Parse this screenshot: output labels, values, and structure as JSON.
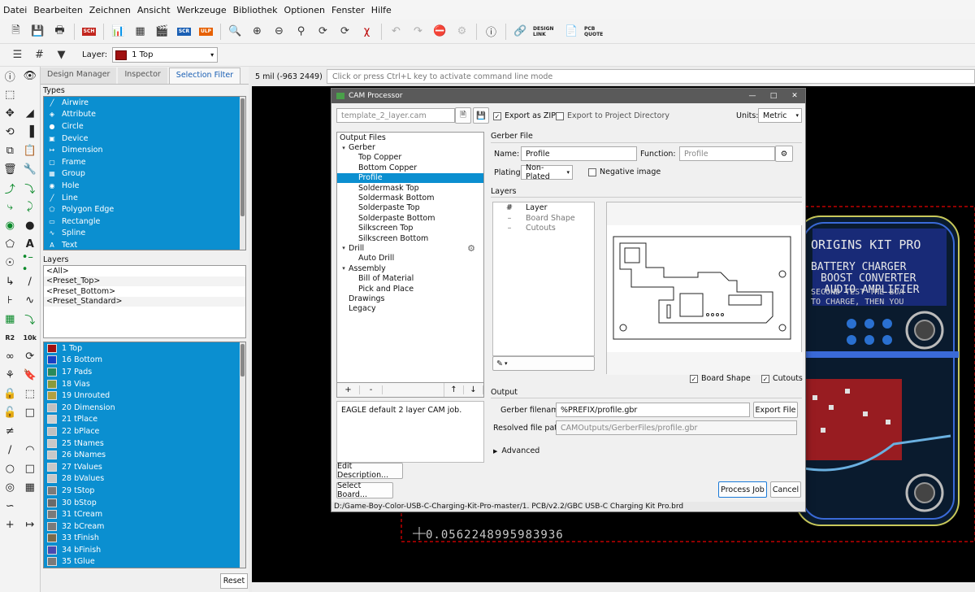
{
  "menubar": [
    "Datei",
    "Bearbeiten",
    "Zeichnen",
    "Ansicht",
    "Werkzeuge",
    "Bibliothek",
    "Optionen",
    "Fenster",
    "Hilfe"
  ],
  "toolbar": {
    "sch_label": "SCH",
    "scr_label": "SCR",
    "ulp_label": "ULP",
    "design_link": "DESIGN LINK",
    "pcb_quote": "PCB QUOTE",
    "layer_label": "Layer:",
    "layer_value": "1 Top",
    "layer_color": "#a01010"
  },
  "panel": {
    "tabs": [
      "Design Manager",
      "Inspector",
      "Selection Filter"
    ],
    "active_tab": "Selection Filter",
    "types_title": "Types",
    "types": [
      "Airwire",
      "Attribute",
      "Circle",
      "Device",
      "Dimension",
      "Frame",
      "Group",
      "Hole",
      "Line",
      "Polygon Edge",
      "Rectangle",
      "Spline",
      "Text"
    ],
    "layers_title": "Layers",
    "presets": [
      "<All>",
      "<Preset_Top>",
      "<Preset_Bottom>",
      "<Preset_Standard>"
    ],
    "layers": [
      {
        "name": "1 Top",
        "color": "#a01010"
      },
      {
        "name": "16 Bottom",
        "color": "#1a3fc4"
      },
      {
        "name": "17 Pads",
        "color": "#2a8a5a"
      },
      {
        "name": "18 Vias",
        "color": "#8a9a3a"
      },
      {
        "name": "19 Unrouted",
        "color": "#b0a040"
      },
      {
        "name": "20 Dimension",
        "color": "#c0c0c0"
      },
      {
        "name": "21 tPlace",
        "color": "#d0d0d0"
      },
      {
        "name": "22 bPlace",
        "color": "#c0c0c0"
      },
      {
        "name": "25 tNames",
        "color": "#c8c8c8"
      },
      {
        "name": "26 bNames",
        "color": "#c8c8c8"
      },
      {
        "name": "27 tValues",
        "color": "#c8c8c8"
      },
      {
        "name": "28 bValues",
        "color": "#c8c8c8"
      },
      {
        "name": "29 tStop",
        "color": "#7a7a7a"
      },
      {
        "name": "30 bStop",
        "color": "#6a6a6a"
      },
      {
        "name": "31 tCream",
        "color": "#7a7a7a"
      },
      {
        "name": "32 bCream",
        "color": "#7a7a7a"
      },
      {
        "name": "33 tFinish",
        "color": "#7a6a4a"
      },
      {
        "name": "34 bFinish",
        "color": "#4a4ab0"
      },
      {
        "name": "35 tGlue",
        "color": "#7a7a7a"
      }
    ],
    "reset_label": "Reset"
  },
  "command": {
    "coord": "5 mil (-963 2449)",
    "placeholder": "Click or press Ctrl+L key to activate command line mode"
  },
  "canvas": {
    "silk_lines": [
      "ORIGINS KIT PRO",
      "BATTERY CHARGER",
      "BOOST CONVERTER",
      "AUDIO AMPLIFIER",
      "SECOND TEST THE BOA",
      "TO CHARGE, THEN YOU"
    ],
    "measure_value": "0.0562248995983936"
  },
  "cam": {
    "title": "CAM Processor",
    "job_file": "template_2_layer.cam",
    "export_zip": "Export as ZIP",
    "export_zip_checked": true,
    "export_project": "Export to Project Directory",
    "export_project_checked": false,
    "units_label": "Units:",
    "units_value": "Metric",
    "output_files_title": "Output Files",
    "tree": [
      {
        "label": "Gerber",
        "level": 0,
        "expand": true
      },
      {
        "label": "Top Copper",
        "level": 1
      },
      {
        "label": "Bottom Copper",
        "level": 1
      },
      {
        "label": "Profile",
        "level": 1,
        "selected": true
      },
      {
        "label": "Soldermask Top",
        "level": 1
      },
      {
        "label": "Soldermask Bottom",
        "level": 1
      },
      {
        "label": "Solderpaste Top",
        "level": 1
      },
      {
        "label": "Solderpaste Bottom",
        "level": 1
      },
      {
        "label": "Silkscreen Top",
        "level": 1
      },
      {
        "label": "Silkscreen Bottom",
        "level": 1
      },
      {
        "label": "Drill",
        "level": 0,
        "expand": true,
        "gear": true
      },
      {
        "label": "Auto Drill",
        "level": 1
      },
      {
        "label": "Assembly",
        "level": 0,
        "expand": true
      },
      {
        "label": "Bill of Material",
        "level": 1
      },
      {
        "label": "Pick and Place",
        "level": 1
      },
      {
        "label": "Drawings",
        "level": 0
      },
      {
        "label": "Legacy",
        "level": 0
      }
    ],
    "tree_buttons": [
      "+",
      "-",
      "↑",
      "↓"
    ],
    "description": "EAGLE default 2 layer CAM job.",
    "edit_description": "Edit Description...",
    "select_board": "Select Board...",
    "gerber_file_title": "Gerber File",
    "name_label": "Name:",
    "name_value": "Profile",
    "function_label": "Function:",
    "function_value": "Profile",
    "plating_label": "Plating:",
    "plating_value": "Non-Plated",
    "negative_image": "Negative image",
    "layers_title": "Layers",
    "layer_col_hash": "#",
    "layer_col_name": "Layer",
    "layer_rows": [
      {
        "mark": "–",
        "name": "Board Shape"
      },
      {
        "mark": "–",
        "name": "Cutouts"
      }
    ],
    "board_shape_chk": "Board Shape",
    "cutouts_chk": "Cutouts",
    "output_title": "Output",
    "gerber_filename_label": "Gerber filename:",
    "gerber_filename_value": "%PREFIX/profile.gbr",
    "export_file": "Export File",
    "resolved_label": "Resolved file path:",
    "resolved_value": "CAMOutputs/GerberFiles/profile.gbr",
    "advanced": "Advanced",
    "process_job": "Process Job",
    "cancel": "Cancel",
    "status_path": "D:/Game-Boy-Color-USB-C-Charging-Kit-Pro-master/1. PCB/v2.2/GBC USB-C Charging Kit Pro.brd"
  }
}
